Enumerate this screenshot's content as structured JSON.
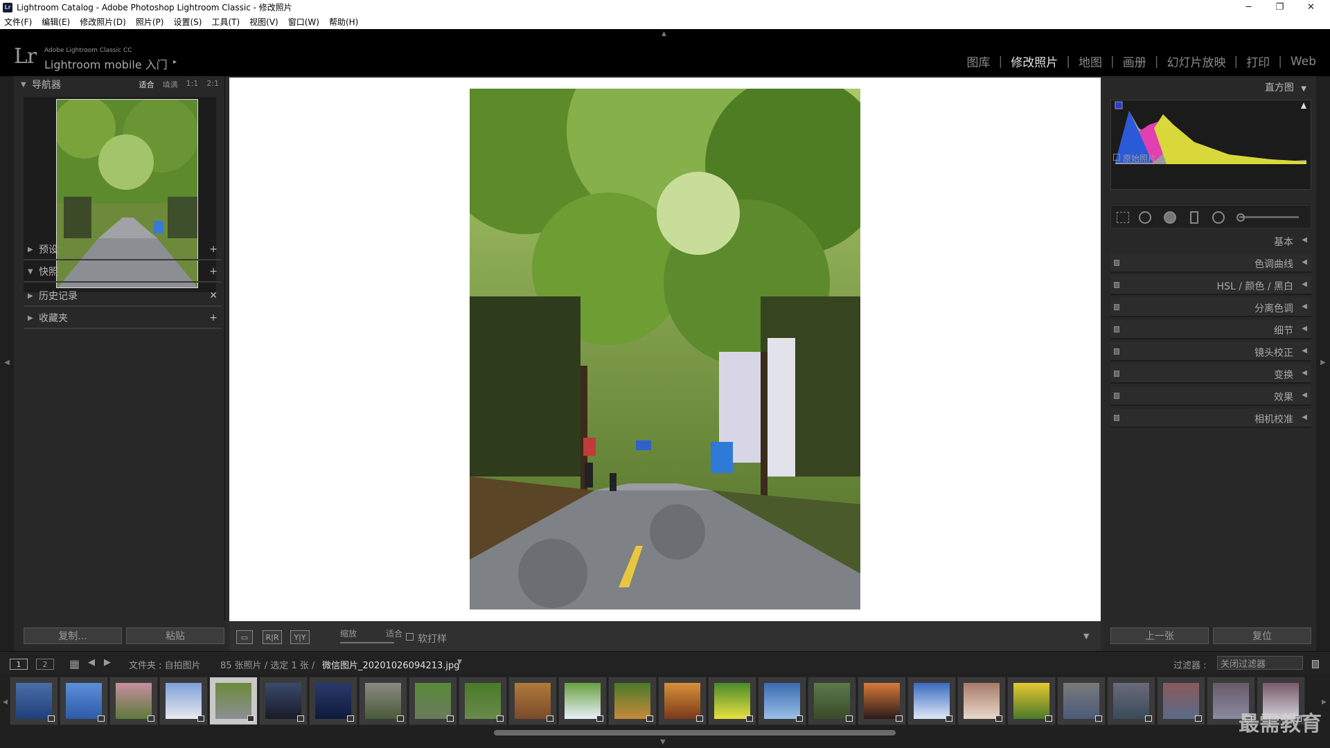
{
  "window": {
    "title": "Lightroom Catalog - Adobe Photoshop Lightroom Classic - 修改照片",
    "app_badge": "Lr",
    "minimize": "─",
    "maximize": "❐",
    "close": "✕"
  },
  "menu": [
    "文件(F)",
    "编辑(E)",
    "修改照片(D)",
    "照片(P)",
    "设置(S)",
    "工具(T)",
    "视图(V)",
    "窗口(W)",
    "帮助(H)"
  ],
  "identity": {
    "logo": "Lr",
    "small": "Adobe Lightroom Classic CC",
    "big": "Lightroom mobile 入门",
    "arrow": "▸",
    "collapse": "▲"
  },
  "modules": [
    "图库",
    "修改照片",
    "地图",
    "画册",
    "幻灯片放映",
    "打印",
    "Web"
  ],
  "active_module": "修改照片",
  "navigator": {
    "title": "导航器",
    "zoom": [
      "适合",
      "填满",
      "1:1",
      "2:1"
    ],
    "zoom_selected": "适合"
  },
  "left_sections": [
    {
      "name": "预设",
      "action": "+"
    },
    {
      "name": "快照",
      "action": "+"
    },
    {
      "name": "历史记录",
      "action": "✕"
    },
    {
      "name": "收藏夹",
      "action": "+"
    }
  ],
  "left_buttons": {
    "copy": "复制...",
    "paste": "粘贴"
  },
  "toolbar": {
    "zoom_label": "缩放",
    "fit_label": "适合",
    "softproof": "软打样",
    "compare_rr": "R|R",
    "compare_yy": "Y|Y"
  },
  "right": {
    "histogram_title": "直方图",
    "original_photo": "原始照片",
    "sections": [
      "基本",
      "色调曲线",
      "HSL / 颜色 / 黑白",
      "分离色调",
      "细节",
      "镜头校正",
      "变换",
      "效果",
      "相机校准"
    ],
    "prev_button": "上一张",
    "reset_button": "复位"
  },
  "filmstrip": {
    "monitor1": "1",
    "monitor2": "2",
    "source": "文件夹 : 自拍图片",
    "count": "85 张照片 / 选定 1 张 /",
    "filename": "微信图片_20201026094213.jpg",
    "filter_label": "过滤器 :",
    "filter_value": "关闭过滤器",
    "selected_index": 4
  },
  "watermark": "最需教育"
}
